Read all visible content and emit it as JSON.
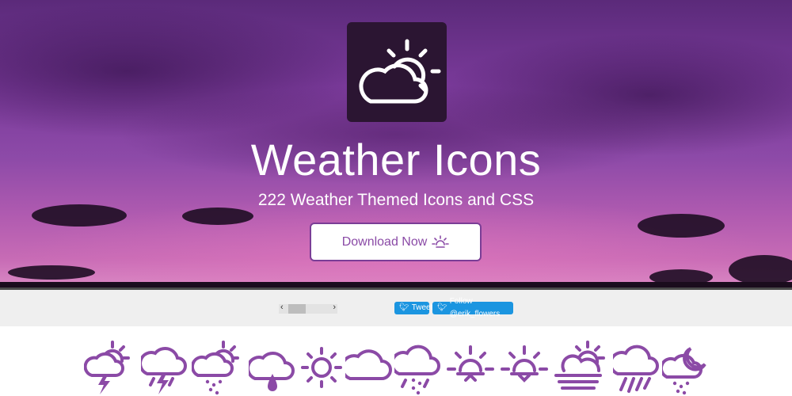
{
  "hero": {
    "title": "Weather Icons",
    "subtitle": "222 Weather Themed Icons and CSS",
    "download_label": "Download Now",
    "logo_icon": "day-cloudy-icon"
  },
  "social": {
    "tweet_label": "Tweet",
    "follow_label": "Follow @erik_flowers"
  },
  "colors": {
    "accent": "#8a4aa6",
    "icon_color": "#8b4aa6",
    "twitter": "#1b95e0"
  },
  "icon_strip": [
    "day-thunderstorm-icon",
    "thunderstorm-icon",
    "day-sleet-icon",
    "raindrops-icon",
    "day-sunny-icon",
    "cloudy-icon",
    "snow-rain-icon",
    "sunrise-icon",
    "sunset-icon",
    "day-fog-icon",
    "rain-icon",
    "night-snow-icon"
  ]
}
